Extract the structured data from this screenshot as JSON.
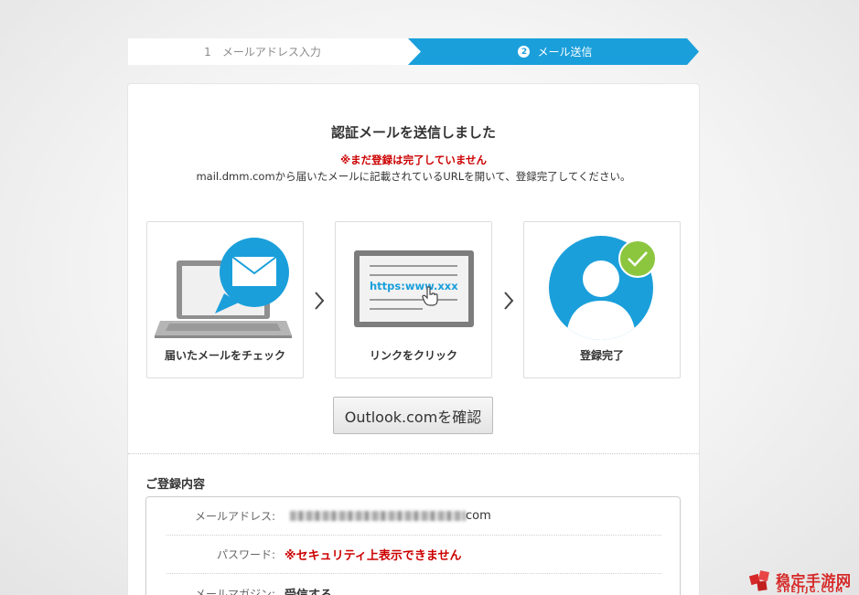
{
  "stepper": {
    "step1_number": "1",
    "step1_label": "メールアドレス入力",
    "step2_number": "2",
    "step2_label": "メール送信"
  },
  "main": {
    "title": "認証メールを送信しました",
    "warning": "※まだ登録は完了していません",
    "description": "mail.dmm.comから届いたメールに記載されているURLを開いて、登録完了してください。"
  },
  "steps": [
    {
      "label": "届いたメールをチェック",
      "icon": "laptop-mail-icon"
    },
    {
      "label": "リンクをクリック",
      "icon": "browser-link-icon",
      "url_text": "https:www.xxx"
    },
    {
      "label": "登録完了",
      "icon": "user-check-icon"
    }
  ],
  "confirm_button": "Outlook.comを確認",
  "registration": {
    "title": "ご登録内容",
    "rows": [
      {
        "label": "メールアドレス:",
        "value": "com"
      },
      {
        "label": "パスワード:",
        "value": "※セキュリティ上表示できません"
      },
      {
        "label": "メールマガジン:",
        "value": "受信する"
      }
    ]
  },
  "watermark": {
    "text": "稳定手游网",
    "sub": "SHEJIJG.COM"
  },
  "colors": {
    "accent": "#1a9fdb",
    "warning": "#cc0000",
    "check": "#8cc63f"
  }
}
